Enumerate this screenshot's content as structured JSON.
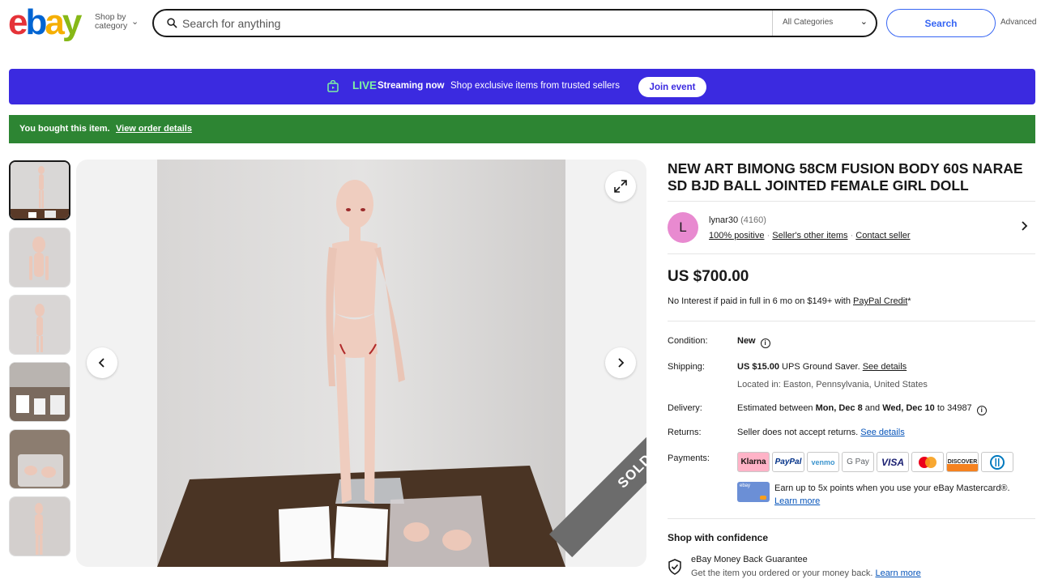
{
  "header": {
    "logo": {
      "e": "e",
      "b": "b",
      "a": "a",
      "y": "y"
    },
    "shop_by_line1": "Shop by",
    "shop_by_line2": "category",
    "search_placeholder": "Search for anything",
    "category_select": "All Categories",
    "search_button": "Search",
    "advanced": "Advanced"
  },
  "live_banner": {
    "label": "LIVE",
    "streaming": "Streaming now",
    "description": "Shop exclusive items from trusted sellers",
    "join_button": "Join event"
  },
  "bought_banner": {
    "text": "You bought this item.",
    "link": "View order details"
  },
  "gallery": {
    "thumbnail_count": 6,
    "active_thumbnail": 1,
    "sold_label": "SOLD"
  },
  "item": {
    "title": "NEW ART BIMONG 58CM FUSION BODY 60S NARAE SD BJD BALL JOINTED FEMALE GIRL DOLL",
    "seller": {
      "avatar_letter": "L",
      "name": "lynar30",
      "score": "(4160)",
      "positive": "100% positive",
      "other_items": "Seller's other items",
      "contact": "Contact seller"
    },
    "price": "US $700.00",
    "credit": {
      "text": "No Interest if paid in full in 6 mo on $149+ with",
      "link": "PayPal Credit",
      "suffix": "*"
    },
    "condition": {
      "label": "Condition:",
      "value": "New"
    },
    "shipping": {
      "label": "Shipping:",
      "cost": "US $15.00",
      "method": "UPS Ground Saver.",
      "link": "See details",
      "located_label": "Located in:",
      "location": "Easton, Pennsylvania, United States"
    },
    "delivery": {
      "label": "Delivery:",
      "prefix": "Estimated between",
      "start": "Mon, Dec 8",
      "and": "and",
      "end": "Wed, Dec 10",
      "to": "to 34987"
    },
    "returns": {
      "label": "Returns:",
      "text": "Seller does not accept returns.",
      "link": "See details"
    },
    "payments": {
      "label": "Payments:",
      "methods": [
        "Klarna",
        "PayPal",
        "venmo",
        "G Pay",
        "VISA",
        "Mastercard",
        "DISCOVER",
        "Diners"
      ]
    },
    "mastercard_promo": {
      "card_label": "ebay",
      "text": "Earn up to 5x points when you use your eBay Mastercard®.",
      "link": "Learn more"
    },
    "confidence": {
      "heading": "Shop with confidence",
      "mbg_title": "eBay Money Back Guarantee",
      "mbg_text": "Get the item you ordered or your money back.",
      "mbg_link": "Learn more"
    }
  },
  "colors": {
    "live_banner": "#3b2ae0",
    "bought_banner": "#2d8533",
    "link": "#0654ba",
    "search_accent": "#3665f3"
  }
}
